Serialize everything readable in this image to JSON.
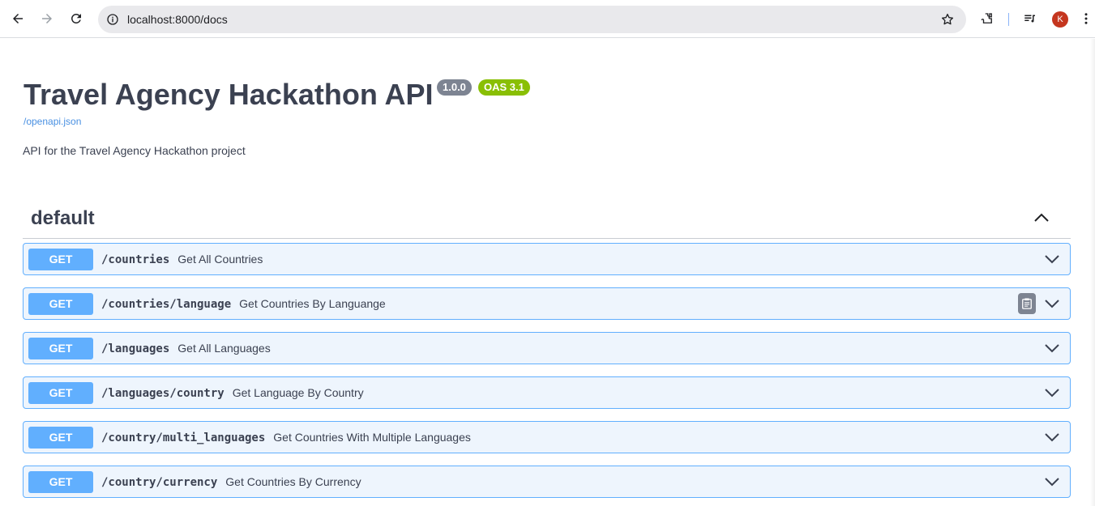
{
  "browser": {
    "url": "localhost:8000/docs",
    "profile_initial": "K",
    "icons": [
      "back-arrow-icon",
      "forward-arrow-icon",
      "reload-icon",
      "site-info-icon",
      "bookmark-star-icon",
      "extensions-icon",
      "media-queue-icon",
      "menu-dots-icon"
    ]
  },
  "api": {
    "title": "Travel Agency Hackathon API",
    "version": "1.0.0",
    "oas": "OAS 3.1",
    "spec_link": "/openapi.json",
    "description": "API for the Travel Agency Hackathon project"
  },
  "tag": {
    "name": "default"
  },
  "operations": [
    {
      "method": "GET",
      "path": "/countries",
      "summary": "Get All Countries"
    },
    {
      "method": "GET",
      "path": "/countries/language",
      "summary": "Get Countries By Languange"
    },
    {
      "method": "GET",
      "path": "/languages",
      "summary": "Get All Languages"
    },
    {
      "method": "GET",
      "path": "/languages/country",
      "summary": "Get Language By Country"
    },
    {
      "method": "GET",
      "path": "/country/multi_languages",
      "summary": "Get Countries With Multiple Languages"
    },
    {
      "method": "GET",
      "path": "/country/currency",
      "summary": "Get Countries By Currency"
    }
  ],
  "colors": {
    "get_method": "#61affe",
    "get_bg": "#eef5fd",
    "version_badge": "#7d8492",
    "oas_badge": "#89bf04",
    "link": "#4990e2"
  }
}
